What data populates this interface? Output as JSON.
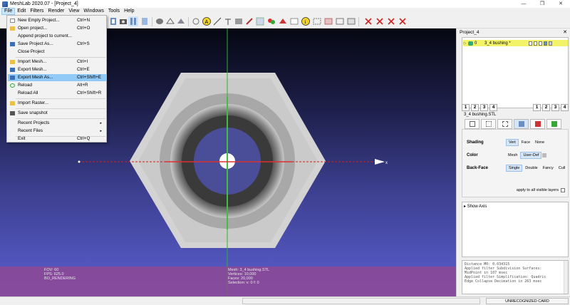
{
  "window": {
    "title": "MeshLab 2020.07 - [Project_4]",
    "controls": [
      "—",
      "❐",
      "✕"
    ]
  },
  "menubar": {
    "items": [
      "File",
      "Edit",
      "Filters",
      "Render",
      "View",
      "Windows",
      "Tools",
      "Help"
    ],
    "active": "File"
  },
  "file_menu": {
    "items": [
      {
        "label": "New Empty Project...",
        "shortcut": "Ctrl+N",
        "icon": "new-project-icon"
      },
      {
        "label": "Open project...",
        "shortcut": "Ctrl+O",
        "icon": "open-folder-icon"
      },
      {
        "label": "Append project to current...",
        "shortcut": "",
        "icon": ""
      },
      {
        "label": "Save Project As...",
        "shortcut": "Ctrl+S",
        "icon": "save-icon"
      },
      {
        "label": "Close Project",
        "shortcut": "",
        "icon": ""
      },
      {
        "label": "Import Mesh...",
        "shortcut": "Ctrl+I",
        "icon": "import-mesh-icon"
      },
      {
        "label": "Export Mesh...",
        "shortcut": "Ctrl+E",
        "icon": "export-mesh-icon"
      },
      {
        "label": "Export Mesh As...",
        "shortcut": "Ctrl+Shift+E",
        "icon": "export-mesh-as-icon"
      },
      {
        "label": "Reload",
        "shortcut": "Alt+R",
        "icon": "reload-icon"
      },
      {
        "label": "Reload All",
        "shortcut": "Ctrl+Shift+R",
        "icon": ""
      },
      {
        "label": "Import Raster...",
        "shortcut": "",
        "icon": "import-raster-icon"
      },
      {
        "label": "Save snapshot",
        "shortcut": "",
        "icon": "snapshot-icon"
      },
      {
        "label": "Recent Projects",
        "shortcut": "",
        "icon": "",
        "submenu": "▸"
      },
      {
        "label": "Recent Files",
        "shortcut": "",
        "icon": "",
        "submenu": "▸"
      },
      {
        "label": "Exit",
        "shortcut": "Ctrl+Q",
        "icon": ""
      }
    ],
    "highlighted": "Export Mesh As..."
  },
  "viewport": {
    "info_left": [
      "FOV: 60",
      "FPS:  625.0",
      "BO_RENDERING"
    ],
    "info_mid": [
      "Mesh: 3_4 bushing.STL",
      "Vertices: 10,000",
      "Faces: 20,000",
      "Selection: v: 0 f: 0"
    ],
    "axis_label": "x"
  },
  "right_panel": {
    "title": "Project_4",
    "close": "✕",
    "layer": {
      "index": "0",
      "name": "3_4 bushing *"
    },
    "layer_buttons": [
      "1",
      "2",
      "3",
      "4"
    ],
    "mesh_name": "3_4 bushing.STL",
    "render": {
      "shading_label": "Shading",
      "shading_options": [
        "Vert",
        "Face",
        "None"
      ],
      "shading_selected": "Vert",
      "color_label": "Color",
      "color_options": [
        "Mesh",
        "User-Def"
      ],
      "color_selected": "User-Def",
      "backface_label": "Back-Face",
      "backface_options": [
        "Single",
        "Double",
        "Fancy",
        "Cull"
      ],
      "backface_selected": "Single",
      "apply_all": "apply to all visible layers"
    },
    "decorators": [
      "Show Axis"
    ],
    "log": [
      "Distance M0: 0.034315",
      "Applied filter Subdivision Surfaces:",
      "MidPoint in 107 msec",
      "Applied filter Simplification: Quadric",
      "Edge Collapse Decimation in 263 msec"
    ]
  },
  "statusbar": {
    "card": "UNRECOGNIZED CARD"
  },
  "colors": {
    "menu_highlight": "#91c9f7",
    "layer_highlight": "#f3f36a",
    "info_overlay": "#96468c",
    "x_axis": "#d02020",
    "y_axis": "#30b030"
  }
}
